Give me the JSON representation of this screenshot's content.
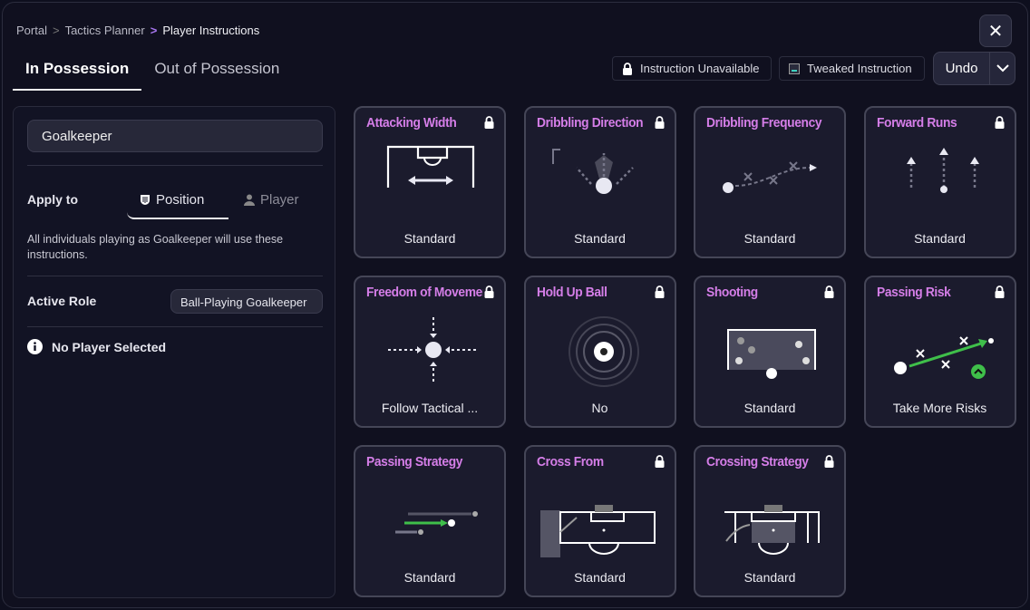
{
  "breadcrumb": [
    "Portal",
    "Tactics Planner",
    "Player Instructions"
  ],
  "tabs": [
    "In Possession",
    "Out of Possession"
  ],
  "legend": {
    "unavailable": "Instruction Unavailable",
    "tweaked": "Tweaked Instruction"
  },
  "undo": "Undo",
  "panel": {
    "position": "Goalkeeper",
    "apply_to": "Apply to",
    "seg_position": "Position",
    "seg_player": "Player",
    "description": "All individuals playing as Goalkeeper will use these instructions.",
    "active_role_label": "Active Role",
    "active_role": "Ball-Playing Goalkeeper",
    "no_player": "No Player Selected"
  },
  "accent": "#d57ee8",
  "cards": [
    {
      "title": "Attacking Width",
      "value": "Standard",
      "locked": true
    },
    {
      "title": "Dribbling Direction",
      "value": "Standard",
      "locked": true
    },
    {
      "title": "Dribbling Frequency",
      "value": "Standard",
      "locked": false
    },
    {
      "title": "Forward Runs",
      "value": "Standard",
      "locked": true
    },
    {
      "title": "Freedom of Movement",
      "value": "Follow Tactical ...",
      "locked": true
    },
    {
      "title": "Hold Up Ball",
      "value": "No",
      "locked": true
    },
    {
      "title": "Shooting",
      "value": "Standard",
      "locked": true
    },
    {
      "title": "Passing Risk",
      "value": "Take More Risks",
      "locked": true
    },
    {
      "title": "Passing Strategy",
      "value": "Standard",
      "locked": false
    },
    {
      "title": "Cross From",
      "value": "Standard",
      "locked": true
    },
    {
      "title": "Crossing Strategy",
      "value": "Standard",
      "locked": true
    }
  ]
}
